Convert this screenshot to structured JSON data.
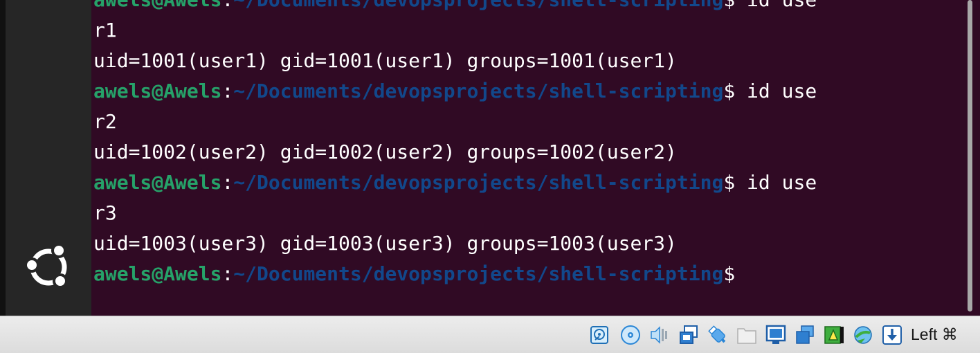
{
  "terminal": {
    "lines": [
      {
        "type": "prompt",
        "user": "awels@Awels",
        "sep": ":",
        "path": "~/Documents/devopsprojects/shell-scripting",
        "dollar": "$",
        "cmd": " id use"
      },
      {
        "type": "output",
        "text": "r1"
      },
      {
        "type": "output",
        "text": "uid=1001(user1) gid=1001(user1) groups=1001(user1)"
      },
      {
        "type": "prompt",
        "user": "awels@Awels",
        "sep": ":",
        "path": "~/Documents/devopsprojects/shell-scripting",
        "dollar": "$",
        "cmd": " id use"
      },
      {
        "type": "output",
        "text": "r2"
      },
      {
        "type": "output",
        "text": "uid=1002(user2) gid=1002(user2) groups=1002(user2)"
      },
      {
        "type": "prompt",
        "user": "awels@Awels",
        "sep": ":",
        "path": "~/Documents/devopsprojects/shell-scripting",
        "dollar": "$",
        "cmd": " id use"
      },
      {
        "type": "output",
        "text": "r3"
      },
      {
        "type": "output",
        "text": "uid=1003(user3) gid=1003(user3) groups=1003(user3)"
      },
      {
        "type": "prompt",
        "user": "awels@Awels",
        "sep": ":",
        "path": "~/Documents/devopsprojects/shell-scripting",
        "dollar": "$",
        "cmd": ""
      }
    ]
  },
  "status_bar": {
    "icons": [
      {
        "name": "hard-disk-icon"
      },
      {
        "name": "optical-drive-icon"
      },
      {
        "name": "audio-icon"
      },
      {
        "name": "network-icon"
      },
      {
        "name": "usb-icon"
      },
      {
        "name": "shared-folders-icon"
      },
      {
        "name": "display-icon"
      },
      {
        "name": "screen-capture-icon"
      },
      {
        "name": "video-recording-icon"
      },
      {
        "name": "virtualization-engine-icon"
      },
      {
        "name": "mouse-integration-icon"
      }
    ],
    "host_key": "Left ⌘"
  },
  "colors": {
    "terminal_bg": "#300a24",
    "prompt_user": "#26a269",
    "prompt_path": "#12488b",
    "text": "#ffffff"
  }
}
